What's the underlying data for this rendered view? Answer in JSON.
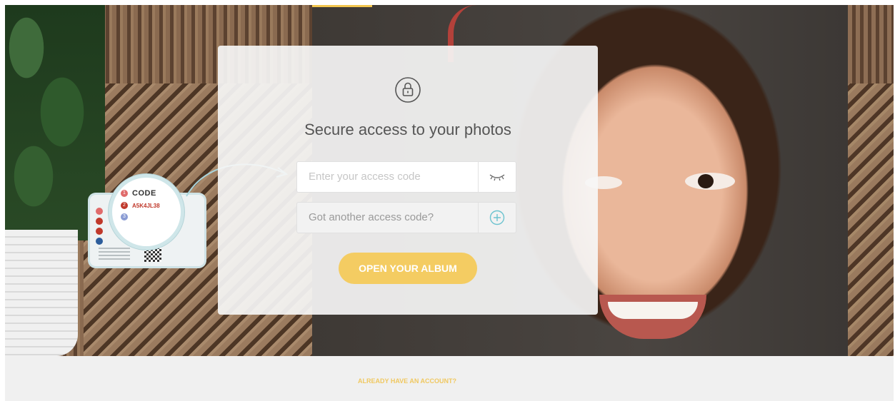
{
  "lock_screen": {
    "title": "Secure access to your photos",
    "access_code_placeholder": "Enter your access code",
    "another_code_label": "Got another access code?",
    "open_button_label": "OPEN YOUR ALBUM"
  },
  "sample_card": {
    "code_label": "CODE",
    "code_value": "A5K4JL38",
    "step_numbers": [
      "1",
      "2",
      "3"
    ]
  },
  "footer": {
    "account_link_label": "ALREADY HAVE AN ACCOUNT?"
  },
  "colors": {
    "accent": "#f4cc62",
    "step_1": "#e06b6b",
    "step_2": "#c0392b",
    "step_3": "#8a9bd3"
  },
  "icons": {
    "lock": "lock-icon",
    "show_password": "eye-closed-icon",
    "add_code": "plus-circle-icon"
  }
}
